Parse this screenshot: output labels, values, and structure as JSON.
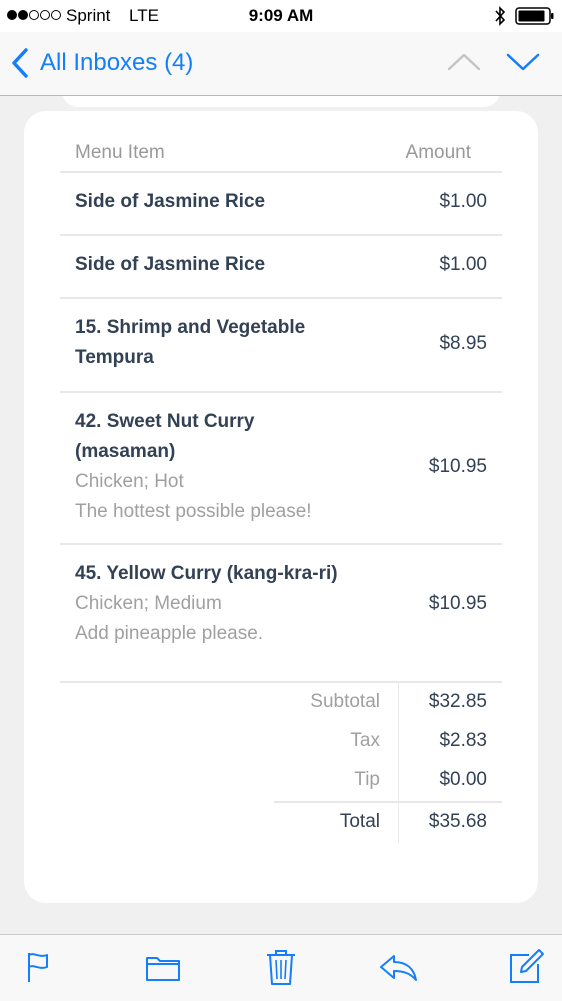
{
  "status_bar": {
    "carrier": "Sprint",
    "network": "LTE",
    "time": "9:09 AM",
    "signal_bars_filled": 2,
    "signal_bars_total": 5,
    "icons": [
      "bluetooth-icon",
      "battery-icon"
    ]
  },
  "nav": {
    "back_label": "All Inboxes (4)",
    "accent_color": "#147efb",
    "icons": [
      "chevron-left-icon",
      "chevron-up-icon",
      "chevron-down-icon"
    ]
  },
  "order": {
    "header": {
      "item": "Menu Item",
      "amount": "Amount"
    },
    "items": [
      {
        "title_lines": [
          "Side of Jasmine Rice"
        ],
        "details": [],
        "amount": "$1.00"
      },
      {
        "title_lines": [
          "Side of Jasmine Rice"
        ],
        "details": [],
        "amount": "$1.00"
      },
      {
        "title_lines": [
          "15. Shrimp and Vegetable",
          "Tempura"
        ],
        "details": [],
        "amount": "$8.95"
      },
      {
        "title_lines": [
          "42. Sweet Nut Curry",
          "(masaman)"
        ],
        "details": [
          "Chicken; Hot",
          "The hottest possible please!"
        ],
        "amount": "$10.95"
      },
      {
        "title_lines": [
          "45. Yellow Curry (kang-kra-ri)"
        ],
        "details": [
          "Chicken; Medium",
          "Add pineapple please."
        ],
        "amount": "$10.95"
      }
    ],
    "totals": {
      "subtotal_label": "Subtotal",
      "subtotal": "$32.85",
      "tax_label": "Tax",
      "tax": "$2.83",
      "tip_label": "Tip",
      "tip": "$0.00",
      "total_label": "Total",
      "total": "$35.68"
    }
  },
  "toolbar": {
    "icons": [
      "flag-icon",
      "folder-icon",
      "trash-icon",
      "reply-icon",
      "compose-icon"
    ]
  }
}
